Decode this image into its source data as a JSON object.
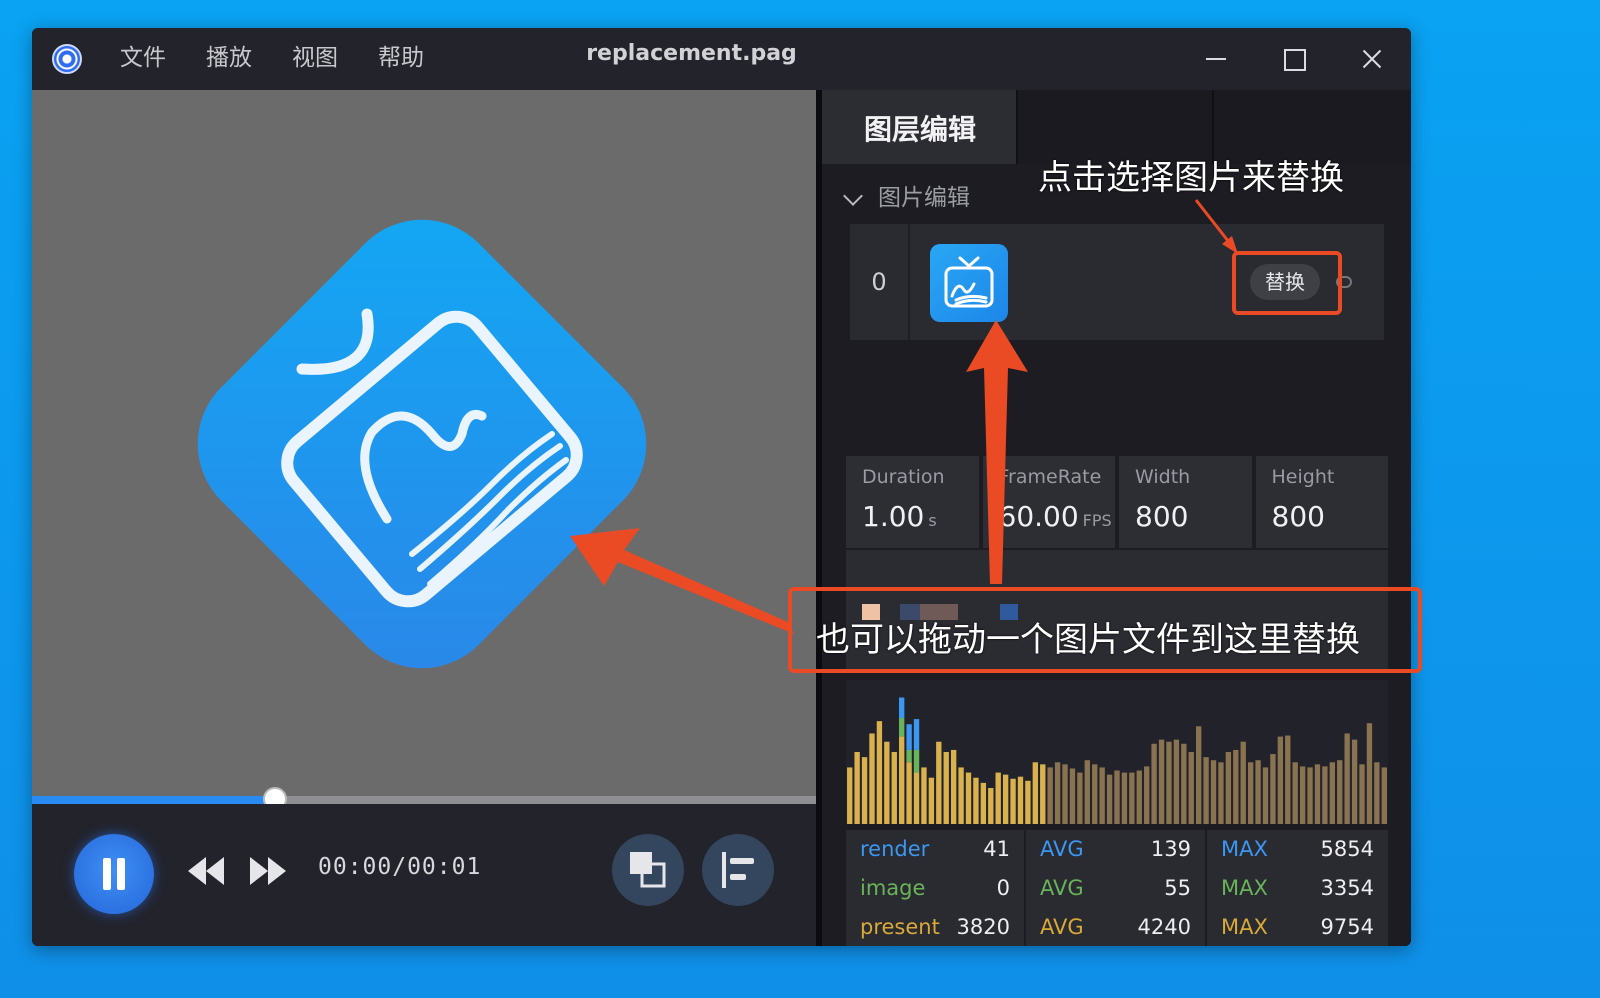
{
  "titlebar": {
    "menu": [
      {
        "label": "文件"
      },
      {
        "label": "播放"
      },
      {
        "label": "视图"
      },
      {
        "label": "帮助"
      }
    ],
    "title": "replacement.pag"
  },
  "player": {
    "progress_fraction": 0.31,
    "time": "00:00/00:01"
  },
  "panel": {
    "tab_label": "图层编辑",
    "section_label": "图片编辑",
    "layer": {
      "index": "0",
      "replace_label": "替换"
    },
    "info": [
      {
        "label": "Duration",
        "value": "1.00",
        "unit": "s"
      },
      {
        "label": "FrameRate",
        "value": "60.00",
        "unit": "FPS"
      },
      {
        "label": "Width",
        "value": "800",
        "unit": ""
      },
      {
        "label": "Height",
        "value": "800",
        "unit": ""
      }
    ],
    "stats": {
      "rows": [
        {
          "name": "render",
          "value": "41",
          "avg_label": "AVG",
          "avg": "139",
          "max_label": "MAX",
          "max": "5854",
          "color": "#3b97f0"
        },
        {
          "name": "image",
          "value": "0",
          "avg_label": "AVG",
          "avg": "55",
          "max_label": "MAX",
          "max": "3354",
          "color": "#69b35a"
        },
        {
          "name": "present",
          "value": "3820",
          "avg_label": "AVG",
          "avg": "4240",
          "max_label": "MAX",
          "max": "9754",
          "color": "#d9a93a"
        }
      ]
    }
  },
  "annotations": {
    "click_hint": "点击选择图片来替换",
    "drag_hint": "也可以拖动一个图片文件到这里替换"
  },
  "colors": {
    "accent": "#2a8bf2",
    "annotation": "#ea4b25",
    "bar_present": "#d9b24d",
    "bar_dim": "#8a7350",
    "bar_render": "#3b97f0",
    "bar_image": "#69b35a"
  },
  "chart_data": {
    "type": "bar",
    "title": "",
    "series": [
      {
        "name": "present",
        "values": [
          55,
          70,
          65,
          88,
          100,
          80,
          70,
          85,
          60,
          50,
          55,
          45,
          80,
          70,
          72,
          55,
          50,
          45,
          40,
          35,
          50,
          48,
          44,
          46,
          42,
          60,
          58,
          55,
          60,
          58,
          54,
          50,
          62,
          58,
          55,
          48,
          52,
          50,
          50,
          52,
          56,
          78,
          82,
          80,
          82,
          78,
          70,
          95,
          65,
          62,
          60,
          70,
          72,
          80,
          60,
          62,
          55,
          68,
          85,
          86,
          60,
          56,
          55,
          58,
          56,
          60,
          62,
          88,
          82,
          58,
          98,
          60,
          55
        ]
      },
      {
        "name": "image",
        "values": [
          0,
          0,
          0,
          0,
          0,
          0,
          0,
          18,
          12,
          22,
          0,
          0,
          0,
          0,
          0,
          0,
          0,
          0,
          0,
          0,
          0,
          0,
          0,
          0,
          0,
          0,
          0,
          0,
          0,
          0,
          0,
          0,
          0,
          0,
          0,
          0,
          0,
          0,
          0,
          0,
          0,
          0,
          0,
          0,
          0,
          0,
          0,
          0,
          0,
          0,
          0,
          0,
          0,
          0,
          0,
          0,
          0,
          0,
          0,
          0,
          0,
          0,
          0,
          0,
          0,
          0,
          0,
          0,
          0,
          0,
          0,
          0,
          0
        ]
      },
      {
        "name": "render",
        "values": [
          0,
          0,
          0,
          0,
          0,
          0,
          0,
          20,
          25,
          30,
          0,
          0,
          0,
          0,
          0,
          0,
          0,
          0,
          0,
          0,
          0,
          0,
          0,
          0,
          0,
          0,
          0,
          0,
          0,
          0,
          0,
          0,
          0,
          0,
          0,
          0,
          0,
          0,
          0,
          0,
          0,
          0,
          0,
          0,
          0,
          0,
          0,
          0,
          0,
          0,
          0,
          0,
          0,
          0,
          0,
          0,
          0,
          0,
          0,
          0,
          0,
          0,
          0,
          0,
          0,
          0,
          0,
          0,
          0,
          0,
          0,
          0,
          0
        ]
      }
    ]
  }
}
